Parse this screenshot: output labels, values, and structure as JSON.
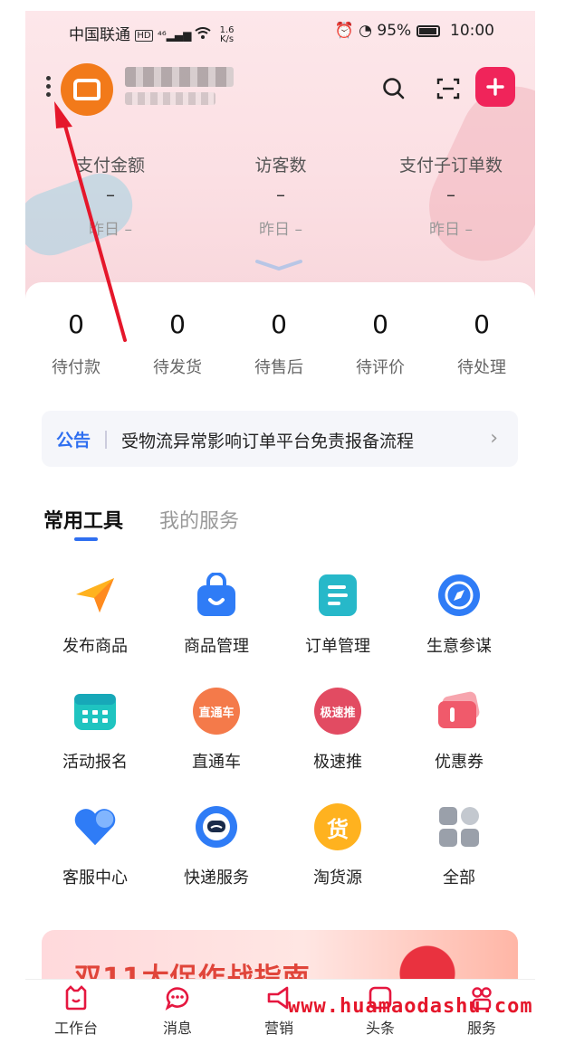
{
  "status_bar": {
    "carrier": "中国联通",
    "signal": "⁴⁶",
    "net_speed_value": "1.6",
    "net_speed_unit": "K/s",
    "battery": "95%",
    "time": "10:00"
  },
  "metrics": [
    {
      "label": "支付金额",
      "value": "–",
      "yesterday": "昨日 –"
    },
    {
      "label": "访客数",
      "value": "–",
      "yesterday": "昨日 –"
    },
    {
      "label": "支付子订单数",
      "value": "–",
      "yesterday": "昨日 –"
    }
  ],
  "orders": [
    {
      "count": "0",
      "label": "待付款"
    },
    {
      "count": "0",
      "label": "待发货"
    },
    {
      "count": "0",
      "label": "待售后"
    },
    {
      "count": "0",
      "label": "待评价"
    },
    {
      "count": "0",
      "label": "待处理"
    }
  ],
  "notice": {
    "tag": "公告",
    "text": "受物流异常影响订单平台免责报备流程",
    "arrow": "›"
  },
  "tabs": {
    "active": "常用工具",
    "inactive": "我的服务"
  },
  "tools": [
    {
      "label": "发布商品",
      "icon": "paper-plane-icon",
      "color": "#ffb21f"
    },
    {
      "label": "商品管理",
      "icon": "shopping-bag-icon",
      "color": "#2f7cf6"
    },
    {
      "label": "订单管理",
      "icon": "document-icon",
      "color": "#27b8c9"
    },
    {
      "label": "生意参谋",
      "icon": "compass-icon",
      "color": "#2f7cf6"
    },
    {
      "label": "活动报名",
      "icon": "calendar-icon",
      "color": "#1fc4c0"
    },
    {
      "label": "直通车",
      "icon": "through-train-icon",
      "color": "#f47a4a",
      "badge": "直通车"
    },
    {
      "label": "极速推",
      "icon": "speed-push-icon",
      "color": "#e24b62",
      "badge": "极速推"
    },
    {
      "label": "优惠券",
      "icon": "coupon-icon",
      "color": "#f05a6b"
    },
    {
      "label": "客服中心",
      "icon": "heart-chat-icon",
      "color": "#2f7cf6"
    },
    {
      "label": "快递服务",
      "icon": "courier-icon",
      "color": "#2f7cf6"
    },
    {
      "label": "淘货源",
      "icon": "source-1688-icon",
      "color": "#ffb21f",
      "badge": "货"
    },
    {
      "label": "全部",
      "icon": "all-apps-icon",
      "color": "#9aa0aa"
    }
  ],
  "banner": {
    "text": "双11大促作战指南"
  },
  "bottom_nav": [
    {
      "label": "工作台",
      "icon": "workbench-icon",
      "active": true
    },
    {
      "label": "消息",
      "icon": "message-icon"
    },
    {
      "label": "营销",
      "icon": "megaphone-icon"
    },
    {
      "label": "头条",
      "icon": "headline-icon"
    },
    {
      "label": "服务",
      "icon": "service-icon"
    }
  ],
  "watermark": "www.huamaodashu.com",
  "colors": {
    "accent_red": "#f0245a",
    "brand_orange": "#f27a1a",
    "link_blue": "#2f6ff0",
    "annotation_red": "#e5172b"
  }
}
